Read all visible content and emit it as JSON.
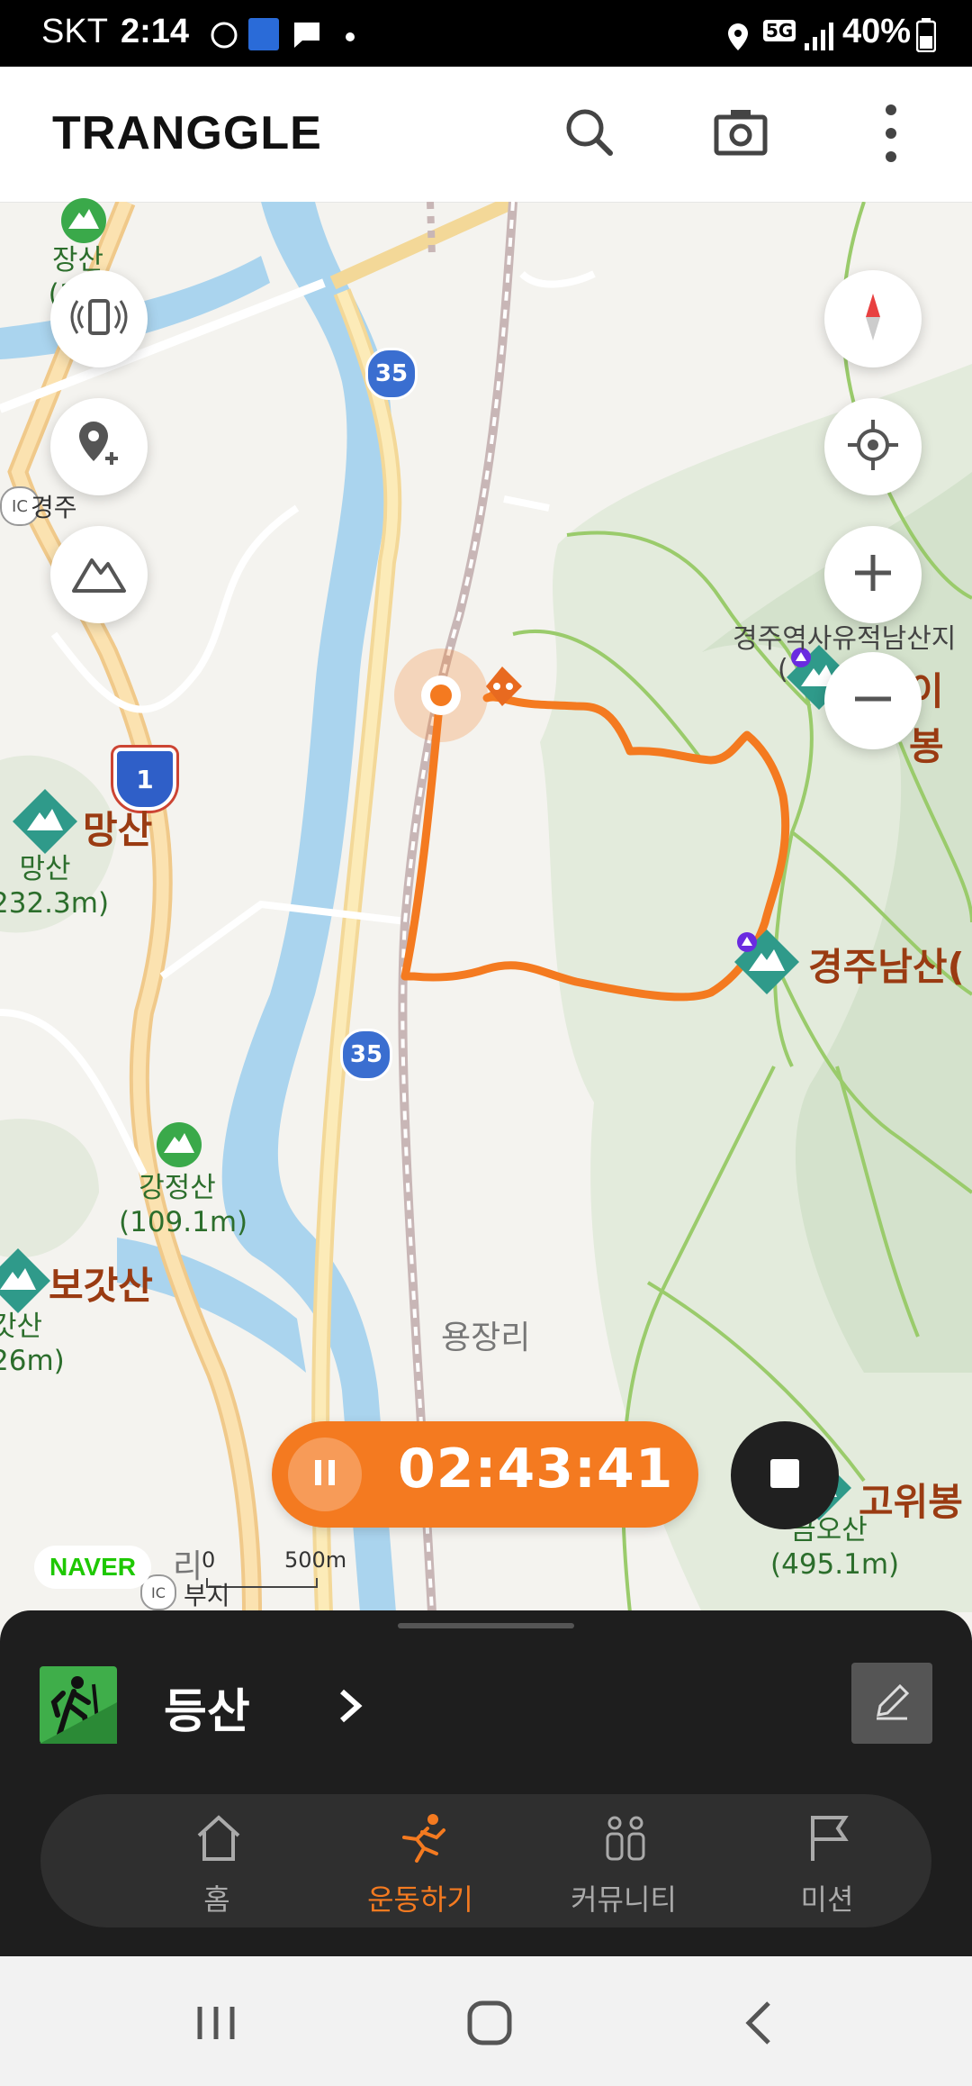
{
  "status_bar": {
    "carrier": "SKT",
    "time": "2:14",
    "battery": "40%",
    "network": "5G"
  },
  "app": {
    "logo": "TRANGGLE"
  },
  "header_icons": [
    "search-icon",
    "camera-icon",
    "more-vert-icon"
  ],
  "map": {
    "peaks": [
      {
        "name": "장산",
        "elev": "(1"
      },
      {
        "name": "망산",
        "elev": "232.3m)"
      },
      {
        "name": "강정산",
        "elev": "(109.1m)"
      },
      {
        "name": "갓산",
        "elev": "26m)"
      },
      {
        "name": "금오산",
        "elev": "(495.1m)"
      }
    ],
    "big_labels": {
      "mangsan": "망산",
      "bogatsan": "보갓산",
      "gyeongju_namsan": "경주남산(",
      "goewibong": "고위봉",
      "ibong": "이봉"
    },
    "places": {
      "yongjangri": "용장리",
      "gyeongju_ic": "경주",
      "buji": "부지",
      "ri": "리",
      "historic": "경주역사유적남산지",
      "historic_paren": "("
    },
    "road_shields": {
      "r35a": "35",
      "r35b": "35",
      "r1": "1"
    },
    "ic_badge": "IC",
    "naver": "NAVER",
    "scale": {
      "zero": "0",
      "dist": "500m"
    }
  },
  "timer": {
    "elapsed": "02:43:41"
  },
  "activity": {
    "label": "등산"
  },
  "tabs": [
    {
      "label": "홈",
      "icon": "home-icon",
      "active": false
    },
    {
      "label": "운동하기",
      "icon": "running-icon",
      "active": true
    },
    {
      "label": "커뮤니티",
      "icon": "community-icon",
      "active": false
    },
    {
      "label": "미션",
      "icon": "flag-icon",
      "active": false
    }
  ],
  "colors": {
    "accent": "#f47a20",
    "sheet": "#1e1e1e",
    "green": "#3fae4a"
  }
}
